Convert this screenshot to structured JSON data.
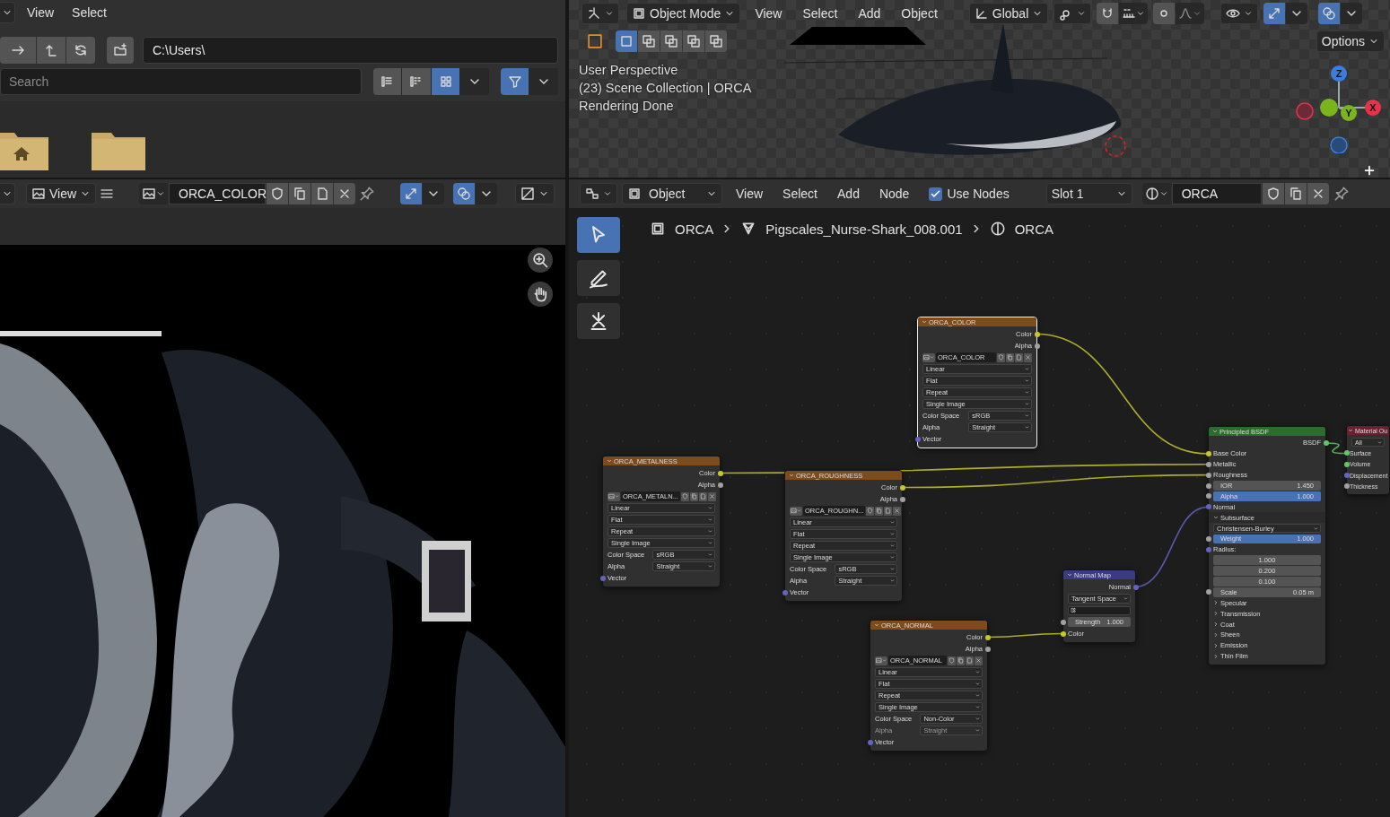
{
  "file_browser": {
    "menu": [
      "View",
      "Select"
    ],
    "path": "C:\\Users\\",
    "search": {
      "placeholder": "Search"
    },
    "display_modes": [
      {
        "kind": "vertical-list",
        "selected": false
      },
      {
        "kind": "horizontal-list",
        "selected": false
      },
      {
        "kind": "thumbnails",
        "selected": true
      }
    ],
    "filter_on": true,
    "folders": [
      {
        "kind": "home"
      },
      {
        "kind": "plain"
      }
    ]
  },
  "image_editor": {
    "view_menu": "View",
    "image": "ORCA_COLOR",
    "gizmo_on": true,
    "overlay_on": true
  },
  "viewport": {
    "mode": "Object Mode",
    "menu": [
      "View",
      "Select",
      "Add",
      "Object"
    ],
    "orientation": "Global",
    "options": "Options",
    "select_modes": [
      {
        "selected": true
      },
      {
        "selected": false
      },
      {
        "selected": false
      },
      {
        "selected": false
      },
      {
        "selected": false
      }
    ],
    "overlay_lines": [
      "User Perspective",
      "(23) Scene Collection | ORCA",
      "Rendering Done"
    ],
    "gizmo_axes": [
      {
        "label": "Z",
        "color": "#3b7ddb"
      },
      {
        "label": "X",
        "color": "#e5334a"
      },
      {
        "label": "Y",
        "color": "#7ab51d"
      }
    ]
  },
  "node_editor": {
    "mode": "Object",
    "menu": [
      "View",
      "Select",
      "Add",
      "Node"
    ],
    "use_nodes": {
      "label": "Use Nodes",
      "checked": true
    },
    "slot": "Slot 1",
    "material": "ORCA",
    "breadcrumbs": [
      {
        "kind": "object",
        "label": "ORCA"
      },
      {
        "kind": "mesh",
        "label": "Pigscales_Nurse-Shark_008.001"
      },
      {
        "kind": "material",
        "label": "ORCA"
      }
    ],
    "tools": [
      {
        "kind": "select",
        "selected": true
      },
      {
        "kind": "annotate",
        "selected": false
      },
      {
        "kind": "cut",
        "selected": false
      }
    ],
    "nodes": [
      {
        "kind": "texture",
        "title": "ORCA_COLOR",
        "selected": true,
        "rows": [
          {
            "kind": "output",
            "label": "Color",
            "color": "#c7c729"
          },
          {
            "kind": "output",
            "label": "Alpha",
            "color": "#a1a1a1"
          },
          {
            "kind": "image",
            "value": "ORCA_COLOR"
          },
          {
            "kind": "dropdown",
            "value": "Linear"
          },
          {
            "kind": "dropdown",
            "value": "Flat"
          },
          {
            "kind": "dropdown",
            "value": "Repeat"
          },
          {
            "kind": "dropdown",
            "value": "Single Image"
          },
          {
            "kind": "field",
            "label": "Color Space",
            "value": "sRGB",
            "disabled": false
          },
          {
            "kind": "field",
            "label": "Alpha",
            "value": "Straight",
            "disabled": false
          },
          {
            "kind": "input",
            "label": "Vector",
            "color": "#6363c7"
          }
        ]
      },
      {
        "kind": "texture",
        "title": "ORCA_METALNESS",
        "selected": false,
        "rows": [
          {
            "kind": "output",
            "label": "Color",
            "color": "#c7c729"
          },
          {
            "kind": "output",
            "label": "Alpha",
            "color": "#a1a1a1"
          },
          {
            "kind": "image",
            "value": "ORCA_METALN..."
          },
          {
            "kind": "dropdown",
            "value": "Linear"
          },
          {
            "kind": "dropdown",
            "value": "Flat"
          },
          {
            "kind": "dropdown",
            "value": "Repeat"
          },
          {
            "kind": "dropdown",
            "value": "Single Image"
          },
          {
            "kind": "field",
            "label": "Color Space",
            "value": "sRGB",
            "disabled": false
          },
          {
            "kind": "field",
            "label": "Alpha",
            "value": "Straight",
            "disabled": false
          },
          {
            "kind": "input",
            "label": "Vector",
            "color": "#6363c7"
          }
        ]
      },
      {
        "kind": "texture",
        "title": "ORCA_ROUGHNESS",
        "selected": false,
        "rows": [
          {
            "kind": "output",
            "label": "Color",
            "color": "#c7c729"
          },
          {
            "kind": "output",
            "label": "Alpha",
            "color": "#a1a1a1"
          },
          {
            "kind": "image",
            "value": "ORCA_ROUGHN..."
          },
          {
            "kind": "dropdown",
            "value": "Linear"
          },
          {
            "kind": "dropdown",
            "value": "Flat"
          },
          {
            "kind": "dropdown",
            "value": "Repeat"
          },
          {
            "kind": "dropdown",
            "value": "Single Image"
          },
          {
            "kind": "field",
            "label": "Color Space",
            "value": "sRGB",
            "disabled": false
          },
          {
            "kind": "field",
            "label": "Alpha",
            "value": "Straight",
            "disabled": false
          },
          {
            "kind": "input",
            "label": "Vector",
            "color": "#6363c7"
          }
        ]
      },
      {
        "kind": "texture",
        "title": "ORCA_NORMAL",
        "selected": false,
        "rows": [
          {
            "kind": "output",
            "label": "Color",
            "color": "#c7c729"
          },
          {
            "kind": "output",
            "label": "Alpha",
            "color": "#a1a1a1"
          },
          {
            "kind": "image",
            "value": "ORCA_NORMAL"
          },
          {
            "kind": "dropdown",
            "value": "Linear"
          },
          {
            "kind": "dropdown",
            "value": "Flat"
          },
          {
            "kind": "dropdown",
            "value": "Repeat"
          },
          {
            "kind": "dropdown",
            "value": "Single Image"
          },
          {
            "kind": "field",
            "label": "Color Space",
            "value": "Non-Color",
            "disabled": false
          },
          {
            "kind": "field",
            "label": "Alpha",
            "value": "Straight",
            "disabled": true
          },
          {
            "kind": "input",
            "label": "Vector",
            "color": "#6363c7"
          }
        ]
      },
      {
        "kind": "vector",
        "title": "Normal Map",
        "selected": false,
        "rows": [
          {
            "kind": "output",
            "label": "Normal",
            "color": "#6363c7"
          },
          {
            "kind": "dropdown",
            "value": "Tangent Space"
          },
          {
            "kind": "uv"
          },
          {
            "kind": "number",
            "label": "Strength",
            "value": "1.000",
            "color": "#a1a1a1"
          },
          {
            "kind": "input",
            "label": "Color",
            "color": "#c7c729"
          }
        ]
      },
      {
        "kind": "shader",
        "title": "Principled BSDF",
        "selected": false,
        "rows": [
          {
            "kind": "output",
            "label": "BSDF",
            "color": "#63c763"
          },
          {
            "kind": "input",
            "label": "Base Color",
            "color": "#c7c729"
          },
          {
            "kind": "input",
            "label": "Metallic",
            "color": "#a1a1a1"
          },
          {
            "kind": "input",
            "label": "Roughness",
            "color": "#a1a1a1"
          },
          {
            "kind": "number",
            "label": "IOR",
            "value": "1.450",
            "color": "#a1a1a1"
          },
          {
            "kind": "slider",
            "label": "Alpha",
            "value": "1.000",
            "level": 1,
            "color": "#a1a1a1"
          },
          {
            "kind": "input",
            "label": "Normal",
            "color": "#6363c7"
          },
          {
            "kind": "panel",
            "label": "Subsurface",
            "expanded": true
          },
          {
            "kind": "dropdown",
            "value": "Christensen-Burley"
          },
          {
            "kind": "slider",
            "label": "Weight",
            "value": "1.000",
            "level": 1,
            "color": "#a1a1a1"
          },
          {
            "kind": "input",
            "label": "Radius:",
            "color": "#6363c7"
          },
          {
            "kind": "vector",
            "value": "1.000"
          },
          {
            "kind": "vector",
            "value": "0.200"
          },
          {
            "kind": "vector",
            "value": "0.100"
          },
          {
            "kind": "number",
            "label": "Scale",
            "value": "0.05 m",
            "color": "#a1a1a1"
          },
          {
            "kind": "panel",
            "label": "Specular",
            "expanded": false
          },
          {
            "kind": "panel",
            "label": "Transmission",
            "expanded": false
          },
          {
            "kind": "panel",
            "label": "Coat",
            "expanded": false
          },
          {
            "kind": "panel",
            "label": "Sheen",
            "expanded": false
          },
          {
            "kind": "panel",
            "label": "Emission",
            "expanded": false
          },
          {
            "kind": "panel",
            "label": "Thin Film",
            "expanded": false
          }
        ]
      },
      {
        "kind": "output",
        "title": "Material Ou",
        "selected": false,
        "rows": [
          {
            "kind": "dropdown",
            "value": "All"
          },
          {
            "kind": "input",
            "label": "Surface",
            "color": "#63c763"
          },
          {
            "kind": "input",
            "label": "Volume",
            "color": "#63c763"
          },
          {
            "kind": "input",
            "label": "Displacement",
            "color": "#6363c7"
          },
          {
            "kind": "input",
            "label": "Thickness",
            "color": "#a1a1a1"
          }
        ]
      }
    ]
  }
}
